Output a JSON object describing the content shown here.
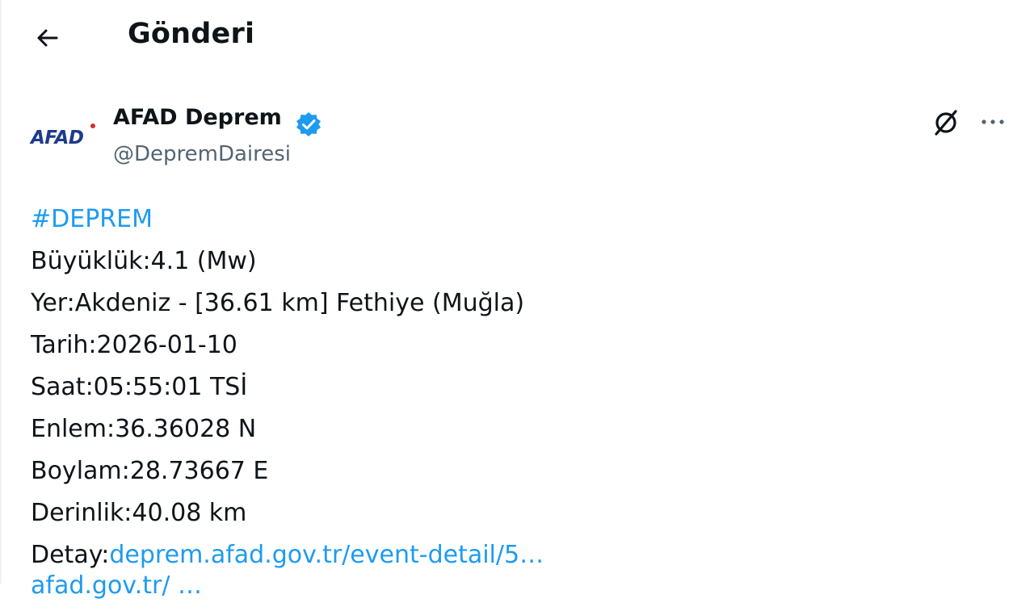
{
  "header": {
    "title": "Gönderi"
  },
  "author": {
    "avatar_text": "AFAD",
    "display_name": "AFAD Deprem",
    "handle": "@DepremDairesi",
    "verified": true
  },
  "actions": {
    "grok_icon": "grok-icon",
    "more_icon": "more-horizontal-icon"
  },
  "tweet": {
    "hashtag": "#DEPREM",
    "lines": {
      "magnitude": "Büyüklük:4.1 (Mw)",
      "location": "Yer:Akdeniz - [36.61 km] Fethiye (Muğla)",
      "date": "Tarih:2026-01-10",
      "time": "Saat:05:55:01 TSİ",
      "latitude": "Enlem:36.36028 N",
      "longitude": "Boylam:28.73667 E",
      "depth": "Derinlik:40.08 km",
      "detail_label": "Detay:",
      "detail_link": "deprem.afad.gov.tr/event-detail/5…",
      "next_link_partial": "afad.gov.tr/ …"
    }
  },
  "colors": {
    "link": "#1d9bf0",
    "verified": "#1d9bf0",
    "text": "#0f1419",
    "secondary": "#536471",
    "afad_logo": "#1f3a8a"
  }
}
